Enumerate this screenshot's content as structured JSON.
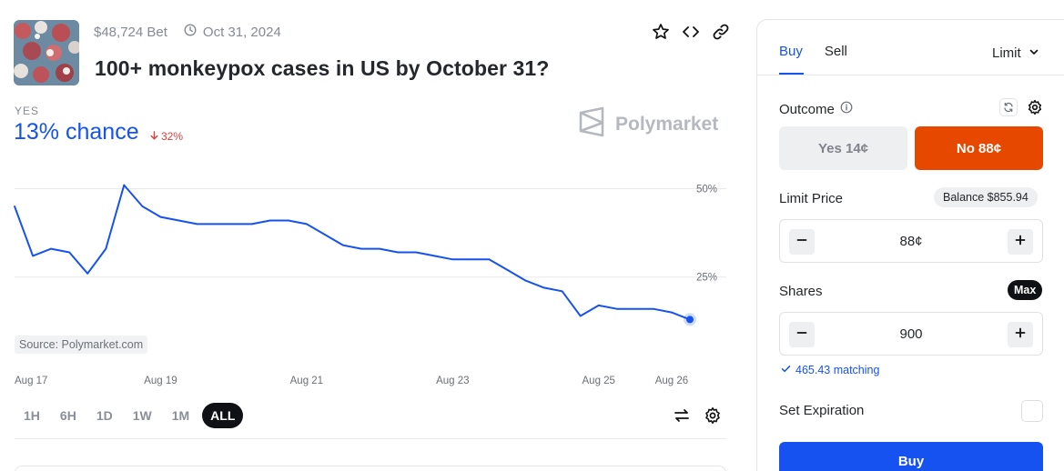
{
  "market": {
    "volume": "$48,724 Bet",
    "end_date": "Oct 31, 2024",
    "title": "100+ monkeypox cases in US by October 31?",
    "outcome_label": "YES",
    "chance": "13% chance",
    "change": "32%",
    "brand": "Polymarket",
    "source": "Source: Polymarket.com"
  },
  "icons": {
    "favorite": "star-icon",
    "embed": "code-icon",
    "share": "link-icon",
    "clock": "clock-icon",
    "swap": "swap-arrows-icon",
    "settings": "gear-icon"
  },
  "chart_data": {
    "type": "line",
    "series": [
      {
        "color": "#1652f0",
        "x": [
          "Aug 17 00:00",
          "Aug 17 06:00",
          "Aug 17 12:00",
          "Aug 17 18:00",
          "Aug 18 00:00",
          "Aug 18 06:00",
          "Aug 18 12:00",
          "Aug 18 18:00",
          "Aug 19 00:00",
          "Aug 19 06:00",
          "Aug 19 12:00",
          "Aug 19 18:00",
          "Aug 20 00:00",
          "Aug 20 06:00",
          "Aug 20 12:00",
          "Aug 20 18:00",
          "Aug 21 00:00",
          "Aug 21 06:00",
          "Aug 21 12:00",
          "Aug 21 18:00",
          "Aug 22 00:00",
          "Aug 22 06:00",
          "Aug 22 12:00",
          "Aug 22 18:00",
          "Aug 23 00:00",
          "Aug 23 06:00",
          "Aug 23 12:00",
          "Aug 23 18:00",
          "Aug 24 00:00",
          "Aug 24 06:00",
          "Aug 24 12:00",
          "Aug 24 18:00",
          "Aug 25 00:00",
          "Aug 25 06:00",
          "Aug 25 12:00",
          "Aug 25 18:00",
          "Aug 26 00:00",
          "Aug 26 06:00"
        ],
        "values": [
          45,
          31,
          33,
          32,
          26,
          33,
          51,
          45,
          42,
          41,
          40,
          40,
          40,
          40,
          41,
          41,
          40,
          37,
          34,
          33,
          33,
          32,
          32,
          31,
          30,
          30,
          30,
          27,
          24,
          22,
          21,
          14,
          17,
          16,
          16,
          16,
          15,
          13
        ]
      }
    ],
    "x_ticks": [
      "Aug 17",
      "Aug 19",
      "Aug 21",
      "Aug 23",
      "Aug 25",
      "Aug 26"
    ],
    "y_ticks": [
      "50%",
      "25%"
    ],
    "ylim": [
      0,
      55
    ],
    "grid": true,
    "title": "",
    "xlabel": "",
    "ylabel": ""
  },
  "ranges": [
    "1H",
    "6H",
    "1D",
    "1W",
    "1M",
    "ALL"
  ],
  "active_range": "ALL",
  "trade": {
    "tab_buy": "Buy",
    "tab_sell": "Sell",
    "order_type": "Limit",
    "outcome_label": "Outcome",
    "yes_button": "Yes 14¢",
    "no_button": "No 88¢",
    "limit_price_label": "Limit Price",
    "balance": "Balance $855.94",
    "limit_price_value": "88¢",
    "shares_label": "Shares",
    "max_label": "Max",
    "shares_value": "900",
    "matching": "465.43 matching",
    "expiration_label": "Set Expiration",
    "buy_button": "Buy"
  },
  "colors": {
    "accent": "#1652f0",
    "no": "#e64800",
    "down": "#e23d3d"
  }
}
